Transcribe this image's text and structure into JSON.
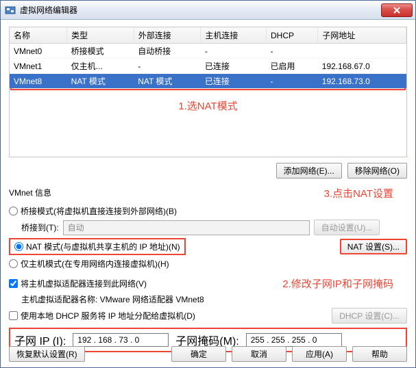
{
  "title": "虚拟网络编辑器",
  "table": {
    "headers": [
      "名称",
      "类型",
      "外部连接",
      "主机连接",
      "DHCP",
      "子网地址"
    ],
    "rows": [
      {
        "name": "VMnet0",
        "type": "桥接模式",
        "ext": "自动桥接",
        "host": "-",
        "dhcp": "-",
        "subnet": ""
      },
      {
        "name": "VMnet1",
        "type": "仅主机...",
        "ext": "-",
        "host": "已连接",
        "dhcp": "已启用",
        "subnet": "192.168.67.0"
      },
      {
        "name": "VMnet8",
        "type": "NAT 模式",
        "ext": "NAT 模式",
        "host": "已连接",
        "dhcp": "-",
        "subnet": "192.168.73.0"
      }
    ]
  },
  "annot1": "1.选NAT模式",
  "annot2": "2.修改子网IP和子网掩码",
  "annot3": "3.点击NAT设置",
  "buttons": {
    "addNet": "添加网络(E)...",
    "removeNet": "移除网络(O)",
    "autoSet": "自动设置(U)...",
    "natSet": "NAT 设置(S)...",
    "dhcpSet": "DHCP 设置(C)...",
    "restore": "恢复默认设置(R)",
    "ok": "确定",
    "cancel": "取消",
    "apply": "应用(A)",
    "help": "帮助"
  },
  "section": {
    "title": "VMnet 信息",
    "bridged": "桥接模式(将虚拟机直接连接到外部网络)(B)",
    "bridgeTo": "桥接到(T):",
    "bridgeAuto": "自动",
    "nat": "NAT 模式(与虚拟机共享主机的 IP 地址)(N)",
    "hostOnly": "仅主机模式(在专用网络内连接虚拟机)(H)",
    "connectHost": "将主机虚拟适配器连接到此网络(V)",
    "adapterName": "主机虚拟适配器名称: VMware 网络适配器 VMnet8",
    "useDhcp": "使用本地 DHCP 服务将 IP 地址分配给虚拟机(D)",
    "subnetIp": "子网 IP (I):",
    "subnetIpVal": "192 . 168 . 73 . 0",
    "subnetMask": "子网掩码(M):",
    "subnetMaskVal": "255 . 255 . 255 . 0"
  },
  "watermark": ""
}
